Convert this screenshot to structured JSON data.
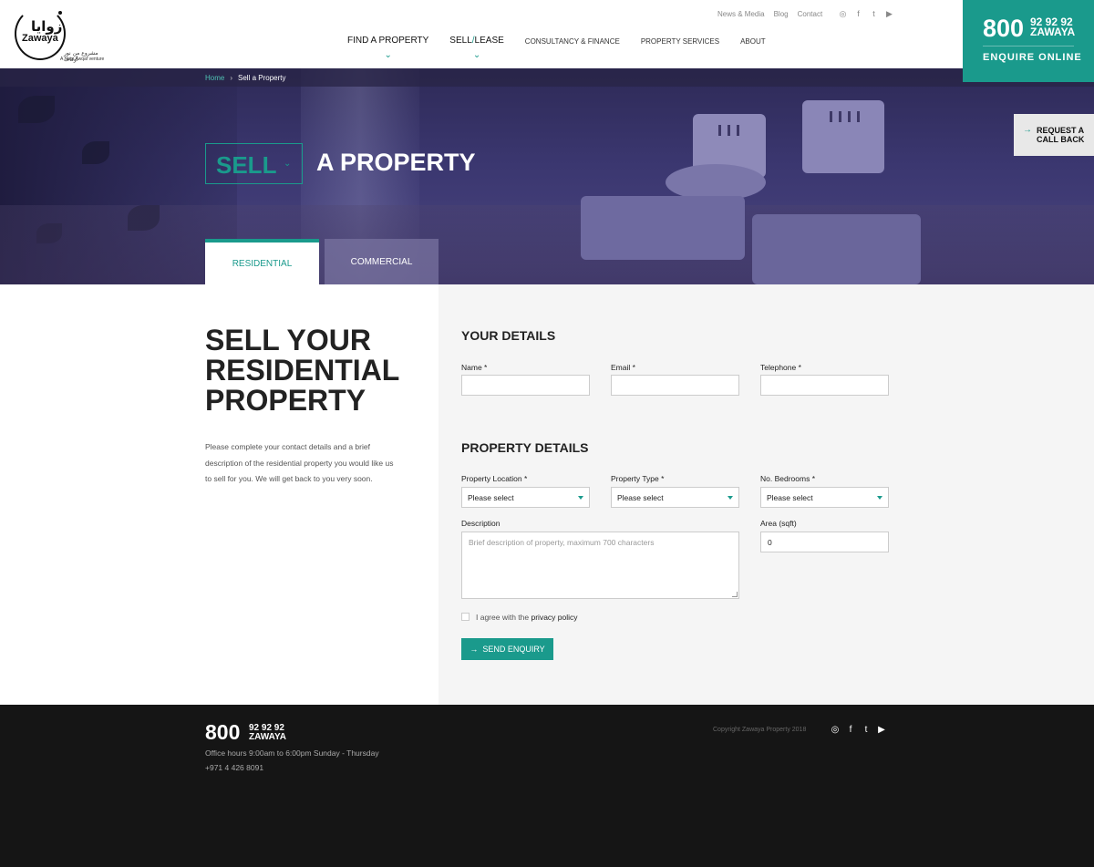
{
  "header": {
    "logo": {
      "arabic": "زوايا",
      "name": "Zawaya",
      "subtitle_ar": "مشروع من نور أوقاف",
      "subtitle_en": "A Noor Awqaf venture"
    },
    "utility_links": [
      "News & Media",
      "Blog",
      "Contact"
    ],
    "social_icons": [
      "◎",
      "f",
      "t",
      "▶"
    ],
    "nav": [
      {
        "label": "FIND A PROPERTY"
      },
      {
        "label": "SELL/LEASE"
      },
      {
        "label": "CONSULTANCY & FINANCE"
      },
      {
        "label": "PROPERTY SERVICES"
      },
      {
        "label": "ABOUT"
      }
    ]
  },
  "cta": {
    "number": "800",
    "digits": "92 92 92",
    "word": "ZAWAYA",
    "enquire": "ENQUIRE ONLINE"
  },
  "hero": {
    "breadcrumb": {
      "home": "Home",
      "separator": "›",
      "current": "Sell a Property"
    },
    "dropdown_value": "SELL",
    "title": "A PROPERTY",
    "callback": {
      "line1": "REQUEST A",
      "line2": "CALL BACK"
    },
    "tabs": {
      "residential": "RESIDENTIAL",
      "commercial": "COMMERCIAL"
    }
  },
  "intro": {
    "heading": "SELL YOUR RESIDENTIAL PROPERTY",
    "text": "Please complete your contact details and a brief description of the residential property you would like us to sell for you. We will get back to you very soon."
  },
  "form": {
    "your_details": "YOUR DETAILS",
    "name_label": "Name *",
    "email_label": "Email *",
    "telephone_label": "Telephone *",
    "property_details": "PROPERTY DETAILS",
    "location_label": "Property Location *",
    "type_label": "Property Type *",
    "bedrooms_label": "No. Bedrooms *",
    "select_placeholder": "Please select",
    "description_label": "Description",
    "description_placeholder": "Brief description of property, maximum 700 characters",
    "area_label": "Area (sqft)",
    "area_value": "0",
    "agree_prefix": "I agree with the",
    "privacy_link": "privacy policy",
    "submit": "SEND ENQUIRY"
  },
  "footer": {
    "number": "800",
    "digits": "92 92 92",
    "word": "ZAWAYA",
    "hours": "Office hours 9:00am to 6:00pm Sunday - Thursday",
    "phone": "+971 4 426 8091",
    "copyright": "Copyright Zawaya Property 2018",
    "social_icons": [
      "◎",
      "f",
      "t",
      "▶"
    ]
  },
  "colors": {
    "accent": "#1a9a8c",
    "footer_bg": "#151515",
    "panel_bg": "#f5f5f5"
  }
}
